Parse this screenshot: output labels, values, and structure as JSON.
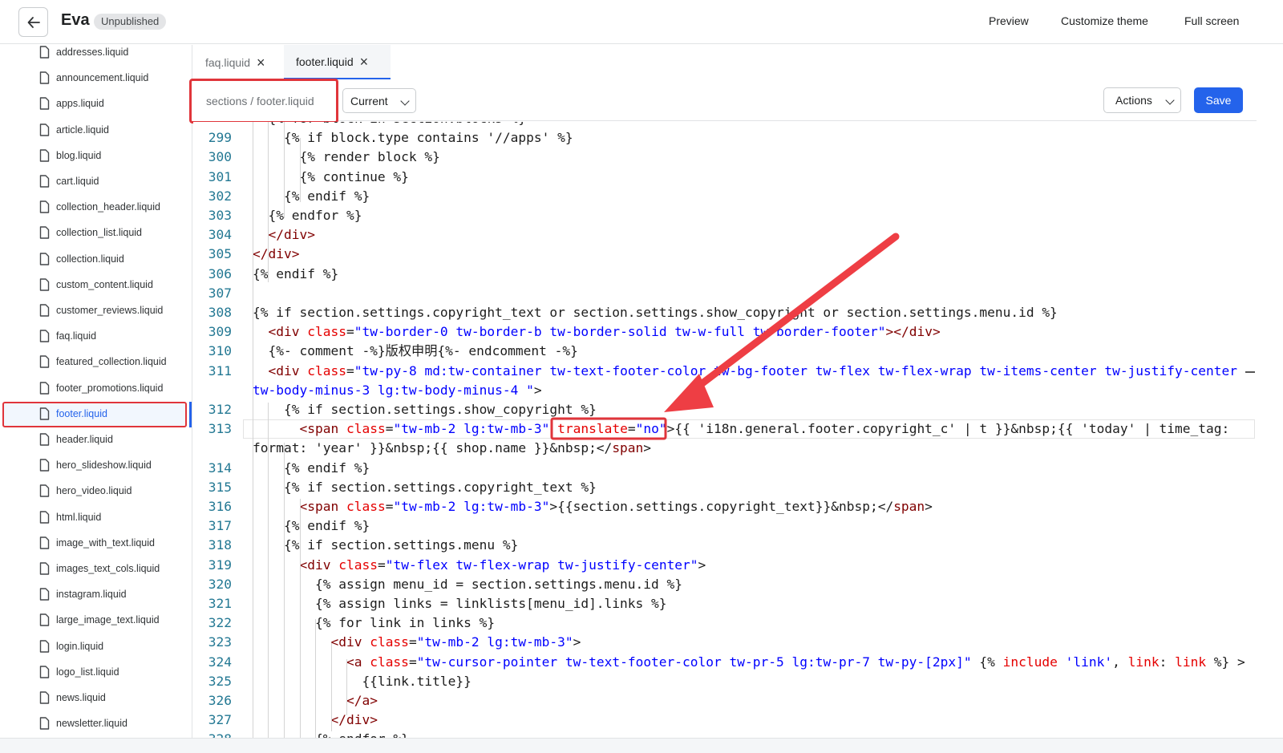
{
  "header": {
    "theme_name": "Eva",
    "status": "Unpublished",
    "preview": "Preview",
    "customize": "Customize theme",
    "fullscreen": "Full screen"
  },
  "sidebar": {
    "files": [
      "addresses.liquid",
      "announcement.liquid",
      "apps.liquid",
      "article.liquid",
      "blog.liquid",
      "cart.liquid",
      "collection_header.liquid",
      "collection_list.liquid",
      "collection.liquid",
      "custom_content.liquid",
      "customer_reviews.liquid",
      "faq.liquid",
      "featured_collection.liquid",
      "footer_promotions.liquid",
      "footer.liquid",
      "header.liquid",
      "hero_slideshow.liquid",
      "hero_video.liquid",
      "html.liquid",
      "image_with_text.liquid",
      "images_text_cols.liquid",
      "instagram.liquid",
      "large_image_text.liquid",
      "login.liquid",
      "logo_list.liquid",
      "news.liquid",
      "newsletter.liquid"
    ],
    "active": "footer.liquid"
  },
  "tabs": [
    {
      "label": "faq.liquid"
    },
    {
      "label": "footer.liquid"
    }
  ],
  "toolbar": {
    "path": "sections / footer.liquid",
    "version": "Current",
    "actions": "Actions",
    "save": "Save"
  },
  "code": [
    {
      "n": "",
      "t": [
        [
          "  {% for block in section.blocks %}",
          ""
        ]
      ]
    },
    {
      "n": "299",
      "t": [
        [
          "    {% if block.type contains '//apps' %}",
          ""
        ]
      ]
    },
    {
      "n": "300",
      "t": [
        [
          "      {% render block %}",
          ""
        ]
      ]
    },
    {
      "n": "301",
      "t": [
        [
          "      {% continue %}",
          ""
        ]
      ]
    },
    {
      "n": "302",
      "t": [
        [
          "    {% endif %}",
          ""
        ]
      ]
    },
    {
      "n": "303",
      "t": [
        [
          "  {% endfor %}",
          ""
        ]
      ]
    },
    {
      "n": "304",
      "t": [
        [
          "  </",
          "k"
        ],
        [
          "div",
          "k"
        ],
        [
          ">",
          "k"
        ]
      ]
    },
    {
      "n": "305",
      "t": [
        [
          "</",
          "k"
        ],
        [
          "div",
          "k"
        ],
        [
          ">",
          "k"
        ]
      ]
    },
    {
      "n": "306",
      "t": [
        [
          "{% endif %}",
          ""
        ]
      ]
    },
    {
      "n": "307",
      "t": [
        [
          "",
          ""
        ]
      ]
    },
    {
      "n": "308",
      "t": [
        [
          "{% if section.settings.copyright_text or section.settings.show_copyright or section.settings.menu.id %}",
          ""
        ]
      ]
    },
    {
      "n": "309",
      "t": [
        [
          "  <",
          "k"
        ],
        [
          "div",
          "k"
        ],
        [
          " class",
          "a"
        ],
        [
          "=",
          ""
        ],
        [
          "\"tw-border-0 tw-border-b tw-border-solid tw-w-full tw-border-footer\"",
          "s"
        ],
        [
          "></",
          "k"
        ],
        [
          "div",
          "k"
        ],
        [
          ">",
          "k"
        ]
      ]
    },
    {
      "n": "310",
      "t": [
        [
          "  {%- comment -%}版权申明{%- endcomment -%}",
          ""
        ]
      ]
    },
    {
      "n": "311",
      "t": [
        [
          "  <",
          "k"
        ],
        [
          "div",
          "k"
        ],
        [
          " class",
          "a"
        ],
        [
          "=",
          ""
        ],
        [
          "\"tw-py-8 md:tw-container tw-text-footer-color tw-bg-footer tw-flex tw-flex-wrap tw-items-center tw-justify-center",
          "s"
        ]
      ]
    },
    {
      "n": "",
      "t": [
        [
          "tw-body-minus-3 lg:tw-body-minus-4 \"",
          "s"
        ],
        [
          ">",
          ""
        ]
      ]
    },
    {
      "n": "312",
      "t": [
        [
          "    {% if section.settings.show_copyright %}",
          ""
        ]
      ]
    },
    {
      "n": "313",
      "t": [
        [
          "      <",
          "k"
        ],
        [
          "span",
          "k"
        ],
        [
          " class",
          "a"
        ],
        [
          "=",
          ""
        ],
        [
          "\"tw-mb-2 lg:tw-mb-3\"",
          "s"
        ],
        [
          " translate",
          "a"
        ],
        [
          "=",
          ""
        ],
        [
          "\"no\"",
          "s"
        ],
        [
          ">{{ 'i18n.general.footer.copyright_c' | t }}&nbsp;{{ 'today' | time_tag:",
          ""
        ]
      ]
    },
    {
      "n": "",
      "t": [
        [
          "format: 'year' }}&nbsp;{{ shop.name }}&nbsp;</",
          ""
        ],
        [
          "span",
          "k"
        ],
        [
          ">",
          ""
        ]
      ]
    },
    {
      "n": "314",
      "t": [
        [
          "    {% endif %}",
          ""
        ]
      ]
    },
    {
      "n": "315",
      "t": [
        [
          "    {% if section.settings.copyright_text %}",
          ""
        ]
      ]
    },
    {
      "n": "316",
      "t": [
        [
          "      <",
          "k"
        ],
        [
          "span",
          "k"
        ],
        [
          " class",
          "a"
        ],
        [
          "=",
          ""
        ],
        [
          "\"tw-mb-2 lg:tw-mb-3\"",
          "s"
        ],
        [
          ">{{section.settings.copyright_text}}&nbsp;</",
          ""
        ],
        [
          "span",
          "k"
        ],
        [
          ">",
          ""
        ]
      ]
    },
    {
      "n": "317",
      "t": [
        [
          "    {% endif %}",
          ""
        ]
      ]
    },
    {
      "n": "318",
      "t": [
        [
          "    {% if section.settings.menu %}",
          ""
        ]
      ]
    },
    {
      "n": "319",
      "t": [
        [
          "      <",
          "k"
        ],
        [
          "div",
          "k"
        ],
        [
          " class",
          "a"
        ],
        [
          "=",
          ""
        ],
        [
          "\"tw-flex tw-flex-wrap tw-justify-center\"",
          "s"
        ],
        [
          ">",
          ""
        ]
      ]
    },
    {
      "n": "320",
      "t": [
        [
          "        {% assign menu_id = section.settings.menu.id %}",
          ""
        ]
      ]
    },
    {
      "n": "321",
      "t": [
        [
          "        {% assign links = linklists[menu_id].links %}",
          ""
        ]
      ]
    },
    {
      "n": "322",
      "t": [
        [
          "        {% for link in links %}",
          ""
        ]
      ]
    },
    {
      "n": "323",
      "t": [
        [
          "          <",
          "k"
        ],
        [
          "div",
          "k"
        ],
        [
          " class",
          "a"
        ],
        [
          "=",
          ""
        ],
        [
          "\"tw-mb-2 lg:tw-mb-3\"",
          "s"
        ],
        [
          ">",
          ""
        ]
      ]
    },
    {
      "n": "324",
      "t": [
        [
          "            <",
          "k"
        ],
        [
          "a",
          "k"
        ],
        [
          " class",
          "a"
        ],
        [
          "=",
          ""
        ],
        [
          "\"tw-cursor-pointer tw-text-footer-color tw-pr-5 lg:tw-pr-7 tw-py-[2px]\"",
          "s"
        ],
        [
          " {% ",
          ""
        ],
        [
          "include",
          "a"
        ],
        [
          " 'link'",
          "s"
        ],
        [
          ", ",
          ""
        ],
        [
          "link",
          "a"
        ],
        [
          ": ",
          ""
        ],
        [
          "link",
          "a"
        ],
        [
          " %} >",
          ""
        ]
      ]
    },
    {
      "n": "325",
      "t": [
        [
          "              {{link.title}}",
          ""
        ]
      ]
    },
    {
      "n": "326",
      "t": [
        [
          "            </",
          "k"
        ],
        [
          "a",
          "k"
        ],
        [
          ">",
          "k"
        ]
      ]
    },
    {
      "n": "327",
      "t": [
        [
          "          </",
          "k"
        ],
        [
          "div",
          "k"
        ],
        [
          ">",
          "k"
        ]
      ]
    },
    {
      "n": "328",
      "t": [
        [
          "        {% endfor %}",
          ""
        ]
      ]
    }
  ]
}
